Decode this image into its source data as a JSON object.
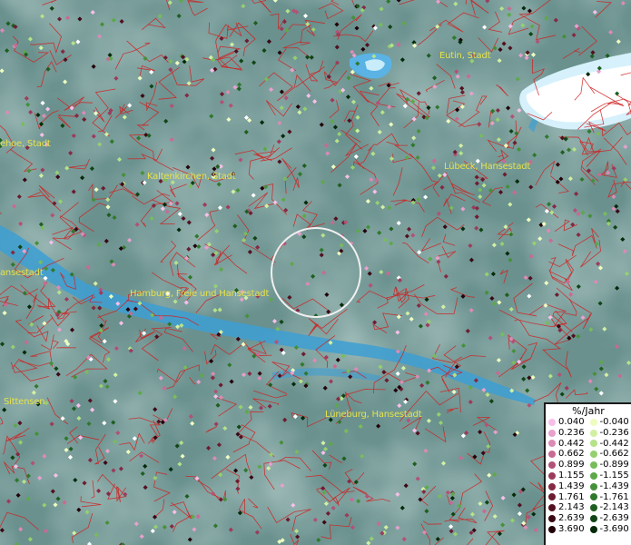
{
  "map": {
    "cities": [
      {
        "id": "eutin",
        "label": "Eutin, Stadt"
      },
      {
        "id": "itzehoe",
        "label": "ehoe, Stadt"
      },
      {
        "id": "kaltenkirchen",
        "label": "Kaltenkirchen, Stadt"
      },
      {
        "id": "luebeck",
        "label": "Lübeck, Hansestadt"
      },
      {
        "id": "hamburg-west",
        "label": "ansestadt"
      },
      {
        "id": "hamburg",
        "label": "Hamburg, Freie und Hansestadt"
      },
      {
        "id": "sittensen",
        "label": "Sittensen"
      },
      {
        "id": "lueneburg",
        "label": "Lüneburg, Hansestadt"
      }
    ],
    "colors": {
      "background": "#6f9592",
      "water": "#3d9fd4",
      "borders": "#d02020",
      "label": "#e6e24a",
      "selection_circle": "#f0f0f0"
    }
  },
  "legend": {
    "title": "%/Jahr",
    "positive": [
      {
        "value": "0.040",
        "color": "#f7bfe8"
      },
      {
        "value": "0.236",
        "color": "#e8a0cc"
      },
      {
        "value": "0.442",
        "color": "#dc8ab6"
      },
      {
        "value": "0.662",
        "color": "#c86a94"
      },
      {
        "value": "0.899",
        "color": "#b25276"
      },
      {
        "value": "1.155",
        "color": "#9c3c5c"
      },
      {
        "value": "1.439",
        "color": "#842a44"
      },
      {
        "value": "1.761",
        "color": "#6c1c30"
      },
      {
        "value": "2.143",
        "color": "#521020"
      },
      {
        "value": "2.639",
        "color": "#3a0814"
      },
      {
        "value": "3.690",
        "color": "#22030a"
      }
    ],
    "negative": [
      {
        "value": "-0.040",
        "color": "#eefcc0"
      },
      {
        "value": "-0.236",
        "color": "#d2f0a4"
      },
      {
        "value": "-0.442",
        "color": "#b6e28a"
      },
      {
        "value": "-0.662",
        "color": "#96d070"
      },
      {
        "value": "-0.899",
        "color": "#78bc5c"
      },
      {
        "value": "-1.155",
        "color": "#5ea84a"
      },
      {
        "value": "-1.439",
        "color": "#46903a"
      },
      {
        "value": "-1.761",
        "color": "#30782c"
      },
      {
        "value": "-2.143",
        "color": "#1e5e20"
      },
      {
        "value": "-2.639",
        "color": "#104414"
      },
      {
        "value": "-3.690",
        "color": "#052a0a"
      }
    ]
  }
}
